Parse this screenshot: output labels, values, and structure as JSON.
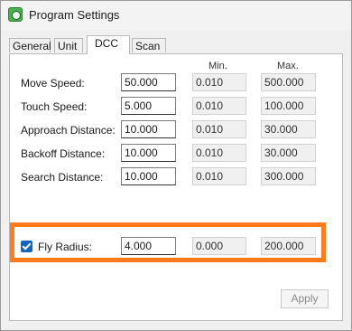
{
  "window": {
    "title": "Program Settings"
  },
  "tabs": [
    "General",
    "Unit",
    "DCC",
    "Scan"
  ],
  "columns": {
    "min": "Min.",
    "max": "Max."
  },
  "rows": [
    {
      "label": "Move Speed:",
      "value": "50.000",
      "min": "0.010",
      "max": "500.000"
    },
    {
      "label": "Touch Speed:",
      "value": "5.000",
      "min": "0.010",
      "max": "100.000"
    },
    {
      "label": "Approach Distance:",
      "value": "10.000",
      "min": "0.010",
      "max": "30.000"
    },
    {
      "label": "Backoff Distance:",
      "value": "10.000",
      "min": "0.010",
      "max": "30.000"
    },
    {
      "label": "Search Distance:",
      "value": "10.000",
      "min": "0.010",
      "max": "300.000"
    }
  ],
  "fly_radius": {
    "label": "Fly Radius:",
    "checked": true,
    "value": "4.000",
    "min": "0.000",
    "max": "200.000"
  },
  "buttons": {
    "apply": "Apply"
  },
  "colors": {
    "highlight": "#ff7a1a",
    "checkbox": "#1565c0"
  }
}
